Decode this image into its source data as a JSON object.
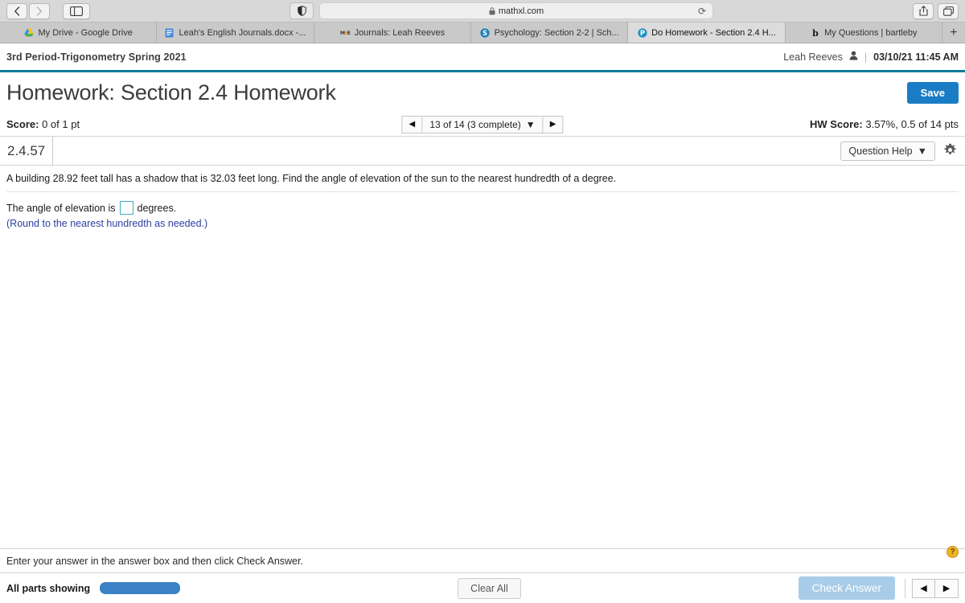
{
  "browser": {
    "back_icon": "back-chevron-icon",
    "forward_icon": "forward-chevron-icon",
    "sidebar_icon": "sidebar-toggle-icon",
    "shield_icon": "privacy-shield-icon",
    "url": "mathxl.com",
    "lock_icon": "lock-icon",
    "reload_icon": "reload-icon",
    "share_icon": "share-icon",
    "tabs_overview_icon": "tab-overview-icon",
    "new_tab_label": "+",
    "tabs": [
      {
        "label": "My Drive - Google Drive",
        "favicon": "google-drive-icon",
        "active": false
      },
      {
        "label": "Leah's English Journals.docx -...",
        "favicon": "word-doc-icon",
        "active": false
      },
      {
        "label": "Journals: Leah Reeves",
        "favicon": "mcgraw-hill-icon",
        "active": false
      },
      {
        "label": "Psychology: Section 2-2 | Sch...",
        "favicon": "schoology-icon",
        "active": false
      },
      {
        "label": "Do Homework - Section 2.4 H...",
        "favicon": "pearson-icon",
        "active": true
      },
      {
        "label": "My Questions | bartleby",
        "favicon": "bartleby-icon",
        "active": false
      }
    ]
  },
  "header": {
    "course_title": "3rd Period-Trigonometry Spring 2021",
    "user_name": "Leah Reeves",
    "user_icon": "user-avatar-icon",
    "separator": "|",
    "datetime": "03/10/21 11:45 AM",
    "page_title": "Homework: Section 2.4 Homework",
    "save_label": "Save",
    "accent_color": "#0e7a9c",
    "save_color": "#1a7cc4"
  },
  "score_bar": {
    "score_label": "Score:",
    "score_value": "0 of 1 pt",
    "prev_icon": "prev-question-icon",
    "next_icon": "next-question-icon",
    "nav_text": "13 of 14 (3 complete)",
    "nav_caret": "caret-down-icon",
    "hw_score_label": "HW Score:",
    "hw_score_value": "3.57%, 0.5 of 14 pts"
  },
  "question_bar": {
    "question_id": "2.4.57",
    "question_help_label": "Question Help",
    "question_help_caret": "caret-down-icon",
    "settings_icon": "gear-icon"
  },
  "question": {
    "prompt": "A building 28.92 feet tall has a shadow that is 32.03 feet long. Find the angle of elevation of the sun to the nearest hundredth of a degree.",
    "answer_prefix": "The angle of elevation is",
    "answer_value": "",
    "answer_placeholder": "",
    "answer_suffix": "degrees.",
    "round_note": "(Round to the nearest hundredth as needed.)",
    "input_border_color": "#3aa7bd"
  },
  "footer": {
    "hint": "Enter your answer in the answer box and then click Check Answer.",
    "help_badge": "?",
    "parts_label": "All parts showing",
    "progress_percent": 100,
    "progress_color": "#3b82c4",
    "clear_all_label": "Clear All",
    "check_answer_label": "Check Answer",
    "check_answer_color": "#a9cde8",
    "prev_icon": "prev-part-icon",
    "next_icon": "next-part-icon"
  }
}
